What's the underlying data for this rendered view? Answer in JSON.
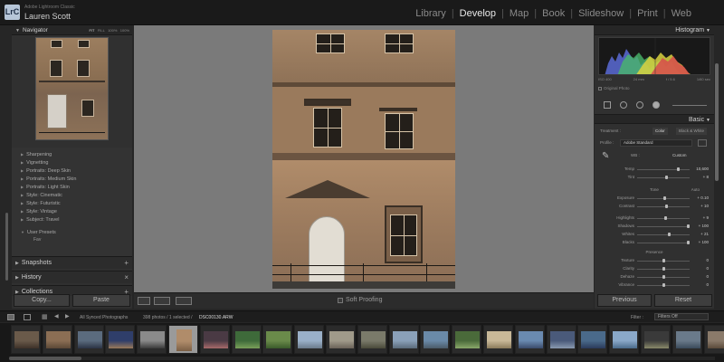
{
  "app": {
    "badge": "LrC",
    "product": "Adobe Lightroom Classic",
    "user": "Lauren Scott"
  },
  "modules": {
    "items": [
      "Library",
      "Develop",
      "Map",
      "Book",
      "Slideshow",
      "Print",
      "Web"
    ],
    "active": "Develop"
  },
  "left_panel": {
    "navigator_title": "Navigator",
    "zoom_options": [
      "FIT",
      "FILL",
      "100%",
      "100%"
    ],
    "preset_groups": [
      "Sharpening",
      "Vignetting",
      "Portraits: Deep Skin",
      "Portraits: Medium Skin",
      "Portraits: Light Skin",
      "Style: Cinematic",
      "Style: Futuristic",
      "Style: Vintage",
      "Subject: Travel"
    ],
    "user_presets_label": "User Presets",
    "user_preset_item": "Fav",
    "snapshots_label": "Snapshots",
    "history_label": "History",
    "collections_label": "Collections",
    "copy_label": "Copy...",
    "paste_label": "Paste"
  },
  "toolbar": {
    "soft_proofing_label": "Soft Proofing"
  },
  "right_panel": {
    "histogram_title": "Histogram",
    "histogram_info": [
      "ISO 400",
      "24 mm",
      "f / 5.6",
      "1/60 sec"
    ],
    "original_photo_label": "Original Photo",
    "basic_title": "Basic",
    "treatment_label": "Treatment :",
    "treatment_color": "Color",
    "treatment_bw": "Black & White",
    "profile_label": "Profile :",
    "profile_value": "Adobe Standard",
    "wb_label": "WB :",
    "wb_value": "Custom",
    "wb_sliders": [
      {
        "label": "Temp",
        "value": "10,600",
        "pos": 0.78
      },
      {
        "label": "Tint",
        "value": "+ 8",
        "pos": 0.55
      }
    ],
    "tone_label": "Tone",
    "auto_label": "Auto",
    "tone_sliders": [
      {
        "label": "Exposure",
        "value": "+ 0.10",
        "pos": 0.52
      },
      {
        "label": "Contrast",
        "value": "+ 10",
        "pos": 0.55
      }
    ],
    "tone_sliders2": [
      {
        "label": "Highlights",
        "value": "+ 9",
        "pos": 0.54
      },
      {
        "label": "Shadows",
        "value": "+ 100",
        "pos": 0.98
      },
      {
        "label": "Whites",
        "value": "+ 21",
        "pos": 0.6
      },
      {
        "label": "Blacks",
        "value": "+ 100",
        "pos": 0.98
      }
    ],
    "presence_label": "Presence",
    "presence_sliders": [
      {
        "label": "Texture",
        "value": "0",
        "pos": 0.5
      },
      {
        "label": "Clarity",
        "value": "0",
        "pos": 0.5
      },
      {
        "label": "Dehaze",
        "value": "0",
        "pos": 0.5
      },
      {
        "label": "Vibrance",
        "value": "0",
        "pos": 0.5
      }
    ],
    "previous_label": "Previous",
    "reset_label": "Reset"
  },
  "filmstrip_bar": {
    "source": "All Synced Photographs",
    "count": "398 photos / 1 selected /",
    "filename": "DSC00130.ARW",
    "filter_label": "Filter :",
    "filter_value": "Filters Off"
  },
  "colors": {
    "accent": "#e8e8e8",
    "panel": "#303030",
    "canvas": "#7a7a7a"
  }
}
